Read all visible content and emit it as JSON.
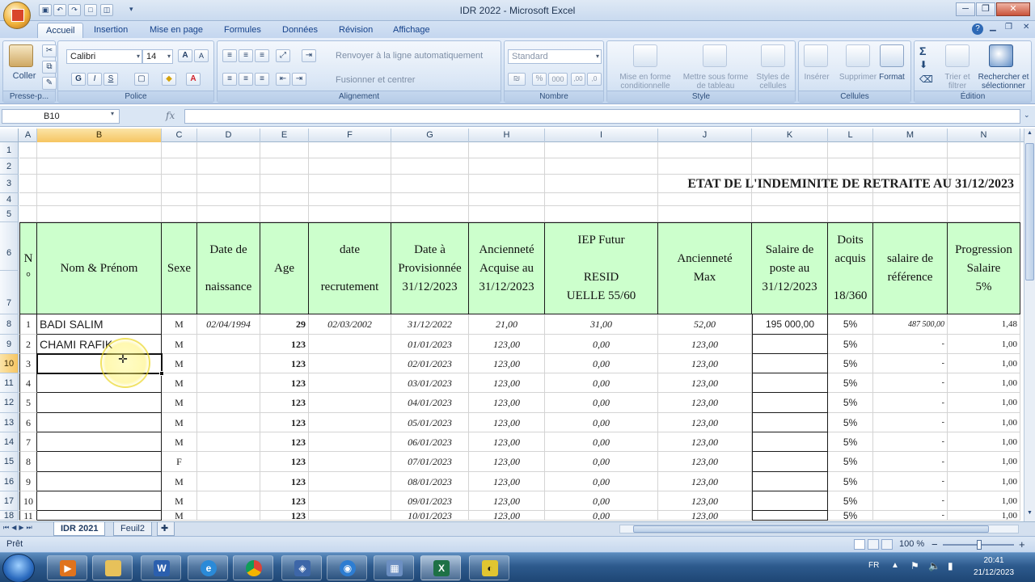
{
  "window": {
    "title": "IDR 2022 - Microsoft Excel",
    "minimize": "─",
    "restore": "❐",
    "close": "✕"
  },
  "tabs": [
    "Accueil",
    "Insertion",
    "Mise en page",
    "Formules",
    "Données",
    "Révision",
    "Affichage"
  ],
  "ribbon": {
    "paste_label": "Coller",
    "clipboard_group": "Presse-p...",
    "font_name": "Calibri",
    "font_size": "14",
    "grow_font": "A",
    "shrink_font": "A",
    "bold": "G",
    "italic": "I",
    "underline": "S",
    "font_color_letter": "A",
    "font_group": "Police",
    "wrap_text": "Renvoyer à la ligne automatiquement",
    "merge_center": "Fusionner et centrer",
    "alignment_group": "Alignement",
    "number_format": "Standard",
    "percent": "%",
    "thousands": "000",
    "decimal_more": ",00",
    "decimal_less": ",0",
    "number_group": "Nombre",
    "cond_format_1": "Mise en forme",
    "cond_format_2": "conditionnelle",
    "table_format_1": "Mettre sous forme",
    "table_format_2": "de tableau",
    "cell_styles_1": "Styles de",
    "cell_styles_2": "cellules",
    "style_group": "Style",
    "insert": "Insérer",
    "delete": "Supprimer",
    "format": "Format",
    "cells_group": "Cellules",
    "sort_1": "Trier et",
    "sort_2": "filtrer",
    "find_1": "Rechercher et",
    "find_2": "sélectionner",
    "edit_group": "Édition"
  },
  "formula_bar": {
    "name_box": "B10",
    "fx": "fx",
    "content": ""
  },
  "columns": [
    "A",
    "B",
    "C",
    "D",
    "E",
    "F",
    "G",
    "H",
    "I",
    "J",
    "K",
    "L",
    "M",
    "N"
  ],
  "selected_column": "B",
  "selected_row": "10",
  "rows_numbers": [
    "1",
    "2",
    "3",
    "4",
    "5",
    "6",
    "7",
    "8",
    "9",
    "10",
    "11",
    "12",
    "13",
    "14",
    "15",
    "16",
    "17",
    "18"
  ],
  "sheet_title": "ETAT DE L'INDEMINITE DE RETRAITE AU 31/12/2023",
  "headers": {
    "a": [
      "N",
      "°"
    ],
    "b": [
      "Nom & Prénom"
    ],
    "c": [
      "Sexe"
    ],
    "d": [
      "Date de",
      "",
      "naissance"
    ],
    "e": [
      "Age"
    ],
    "f": [
      "date",
      "",
      "recrutement"
    ],
    "g": [
      "Date à",
      "Provisionnée",
      "31/12/2023"
    ],
    "h": [
      "Ancienneté",
      "Acquise au",
      "31/12/2023"
    ],
    "i": [
      "IEP Futur",
      "",
      "RESID",
      "UELLE 55/60"
    ],
    "j": [
      "Ancienneté",
      "Max"
    ],
    "k": [
      "Salaire de",
      "poste au",
      "31/12/2023"
    ],
    "l": [
      "Doits",
      "acquis",
      "",
      "18/360"
    ],
    "m": [
      "salaire de",
      "référence"
    ],
    "n": [
      "Progression",
      "Salaire",
      "5%"
    ]
  },
  "data_rows": [
    {
      "n": "1",
      "name": "BADI SALIM",
      "sexe": "M",
      "dob": "02/04/1994",
      "age": "29",
      "recr": "02/03/2002",
      "dprov": "31/12/2022",
      "anc": "21,00",
      "iep": "31,00",
      "ancmax": "52,00",
      "salaire": "195 000,00",
      "doits": "5%",
      "salref": "487 500,00",
      "prog": "1,48"
    },
    {
      "n": "2",
      "name": "CHAMI RAFIK",
      "sexe": "M",
      "dob": "",
      "age": "123",
      "recr": "",
      "dprov": "01/01/2023",
      "anc": "123,00",
      "iep": "0,00",
      "ancmax": "123,00",
      "salaire": "",
      "doits": "5%",
      "salref": "-",
      "prog": "1,00"
    },
    {
      "n": "3",
      "name": "",
      "sexe": "M",
      "dob": "",
      "age": "123",
      "recr": "",
      "dprov": "02/01/2023",
      "anc": "123,00",
      "iep": "0,00",
      "ancmax": "123,00",
      "salaire": "",
      "doits": "5%",
      "salref": "-",
      "prog": "1,00"
    },
    {
      "n": "4",
      "name": "",
      "sexe": "M",
      "dob": "",
      "age": "123",
      "recr": "",
      "dprov": "03/01/2023",
      "anc": "123,00",
      "iep": "0,00",
      "ancmax": "123,00",
      "salaire": "",
      "doits": "5%",
      "salref": "-",
      "prog": "1,00"
    },
    {
      "n": "5",
      "name": "",
      "sexe": "M",
      "dob": "",
      "age": "123",
      "recr": "",
      "dprov": "04/01/2023",
      "anc": "123,00",
      "iep": "0,00",
      "ancmax": "123,00",
      "salaire": "",
      "doits": "5%",
      "salref": "-",
      "prog": "1,00"
    },
    {
      "n": "6",
      "name": "",
      "sexe": "M",
      "dob": "",
      "age": "123",
      "recr": "",
      "dprov": "05/01/2023",
      "anc": "123,00",
      "iep": "0,00",
      "ancmax": "123,00",
      "salaire": "",
      "doits": "5%",
      "salref": "-",
      "prog": "1,00"
    },
    {
      "n": "7",
      "name": "",
      "sexe": "M",
      "dob": "",
      "age": "123",
      "recr": "",
      "dprov": "06/01/2023",
      "anc": "123,00",
      "iep": "0,00",
      "ancmax": "123,00",
      "salaire": "",
      "doits": "5%",
      "salref": "-",
      "prog": "1,00"
    },
    {
      "n": "8",
      "name": "",
      "sexe": "F",
      "dob": "",
      "age": "123",
      "recr": "",
      "dprov": "07/01/2023",
      "anc": "123,00",
      "iep": "0,00",
      "ancmax": "123,00",
      "salaire": "",
      "doits": "5%",
      "salref": "-",
      "prog": "1,00"
    },
    {
      "n": "9",
      "name": "",
      "sexe": "M",
      "dob": "",
      "age": "123",
      "recr": "",
      "dprov": "08/01/2023",
      "anc": "123,00",
      "iep": "0,00",
      "ancmax": "123,00",
      "salaire": "",
      "doits": "5%",
      "salref": "-",
      "prog": "1,00"
    },
    {
      "n": "10",
      "name": "",
      "sexe": "M",
      "dob": "",
      "age": "123",
      "recr": "",
      "dprov": "09/01/2023",
      "anc": "123,00",
      "iep": "0,00",
      "ancmax": "123,00",
      "salaire": "",
      "doits": "5%",
      "salref": "-",
      "prog": "1,00"
    },
    {
      "n": "11",
      "name": "",
      "sexe": "M",
      "dob": "",
      "age": "123",
      "recr": "",
      "dprov": "10/01/2023",
      "anc": "123,00",
      "iep": "0,00",
      "ancmax": "123,00",
      "salaire": "",
      "doits": "5%",
      "salref": "-",
      "prog": "1,00"
    }
  ],
  "sheets": [
    "IDR 2021",
    "Feuil2"
  ],
  "active_sheet": "IDR 2021",
  "status": {
    "ready": "Prêt",
    "zoom": "100 %",
    "zoom_minus": "−",
    "zoom_plus": "+"
  },
  "taskbar": {
    "lang": "FR",
    "time": "20:41",
    "date": "21/12/2023"
  },
  "colors": {
    "header_fill": "#ccffcc",
    "selection_highlight": "#f6c561",
    "ribbon_blue": "#c4d6ef"
  }
}
